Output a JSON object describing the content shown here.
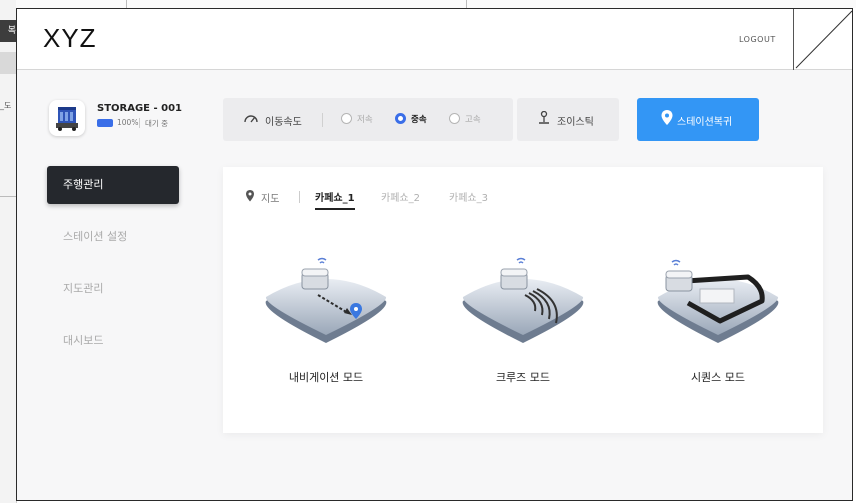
{
  "background_window": {
    "fragment_1": "복",
    "fragment_2": "_도"
  },
  "app": {
    "logo": "XYZ",
    "logout": "LOGOUT"
  },
  "device": {
    "name": "STORAGE - 001",
    "battery_percent": "100%",
    "status": "대기 중",
    "battery_level": 1.0
  },
  "sidebar": {
    "items": [
      {
        "label": "주행관리",
        "active": true
      },
      {
        "label": "스테이션 설정",
        "active": false
      },
      {
        "label": "지도관리",
        "active": false
      },
      {
        "label": "대시보드",
        "active": false
      }
    ]
  },
  "speed": {
    "label": "이동속도",
    "options": [
      {
        "label": "저속",
        "selected": false
      },
      {
        "label": "중속",
        "selected": true
      },
      {
        "label": "고속",
        "selected": false
      }
    ]
  },
  "joystick": {
    "label": "조이스틱",
    "icon": "joystick-icon"
  },
  "station_return": {
    "label": "스테이션복귀",
    "icon": "location-pin-icon"
  },
  "map_tabs": {
    "map_label": "지도",
    "tabs": [
      {
        "label": "카페쇼_1",
        "active": true
      },
      {
        "label": "카페쇼_2",
        "active": false
      },
      {
        "label": "카페쇼_3",
        "active": false
      }
    ]
  },
  "modes": [
    {
      "label": "내비게이션 모드",
      "icon": "navigation-mode-icon"
    },
    {
      "label": "크루즈 모드",
      "icon": "cruise-mode-icon"
    },
    {
      "label": "시퀀스 모드",
      "icon": "sequence-mode-icon"
    }
  ],
  "colors": {
    "accent": "#3396f5",
    "radio_selected": "#3a6ee8",
    "sidebar_active": "#25282d"
  }
}
